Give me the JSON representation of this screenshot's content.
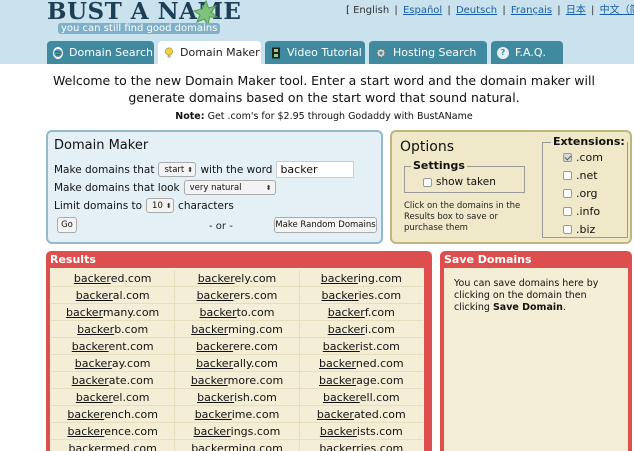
{
  "header": {
    "logo_title": "BUST A NAME",
    "logo_subtitle": "you can still find good domains",
    "languages": [
      {
        "label": "English",
        "active": true
      },
      {
        "label": "Español",
        "active": false
      },
      {
        "label": "Deutsch",
        "active": false
      },
      {
        "label": "Français",
        "active": false
      },
      {
        "label": "日本",
        "active": false
      },
      {
        "label": "中文（简体）",
        "active": false
      }
    ],
    "lang_open": "[",
    "lang_close": "]"
  },
  "tabs": [
    {
      "label": "Domain Search",
      "icon": "globe-icon",
      "active": false
    },
    {
      "label": "Domain Maker",
      "icon": "lightbulb-icon",
      "active": true
    },
    {
      "label": "Video Tutorial",
      "icon": "film-icon",
      "active": false
    },
    {
      "label": "Hosting Search",
      "icon": "gear-icon",
      "active": false
    },
    {
      "label": "F.A.Q.",
      "icon": "help-icon",
      "active": false
    }
  ],
  "welcome": {
    "text": "Welcome to the new Domain Maker tool. Enter a start word and the domain maker will generate domains based on the start word that sound natural.",
    "note_label": "Note:",
    "note_text": "Get .com's for $2.95 through Godaddy with BustAName"
  },
  "domain_maker": {
    "title": "Domain Maker",
    "row1_prefix": "Make domains that",
    "row1_select": "start",
    "row1_suffix": "with the word",
    "word_value": "backer",
    "row2_prefix": "Make domains that look",
    "row2_select": "very natural",
    "row3_prefix": "Limit domains to",
    "row3_select": "10",
    "row3_suffix": "characters",
    "go_label": "Go",
    "or_label": "- or -",
    "random_label": "Make Random Domains"
  },
  "options": {
    "title": "Options",
    "settings_legend": "Settings",
    "show_taken_label": "show taken",
    "hint": "Click on the domains in the Results box to save or purchase them",
    "extensions_legend": "Extensions:",
    "extensions": [
      {
        "label": ".com",
        "checked": true
      },
      {
        "label": ".net",
        "checked": false
      },
      {
        "label": ".org",
        "checked": false
      },
      {
        "label": ".info",
        "checked": false
      },
      {
        "label": ".biz",
        "checked": false
      }
    ]
  },
  "results": {
    "title": "Results",
    "base": "backer",
    "rows": [
      [
        "ed.com",
        "ely.com",
        "ing.com"
      ],
      [
        "al.com",
        "ers.com",
        "ies.com"
      ],
      [
        "many.com",
        "to.com",
        "f.com"
      ],
      [
        "b.com",
        "ming.com",
        "i.com"
      ],
      [
        "ent.com",
        "ere.com",
        "ist.com"
      ],
      [
        "ay.com",
        "ally.com",
        "ned.com"
      ],
      [
        "ate.com",
        "more.com",
        "age.com"
      ],
      [
        "el.com",
        "ish.com",
        "ell.com"
      ],
      [
        "ench.com",
        "ime.com",
        "ated.com"
      ],
      [
        "ence.com",
        "ings.com",
        "ists.com"
      ],
      [
        "med.com",
        "ming.com",
        "ries.com"
      ]
    ]
  },
  "save": {
    "title": "Save Domains",
    "text_before": "You can save domains here by clicking on the domain then clicking",
    "text_bold": "Save Domain",
    "text_after": "."
  },
  "colors": {
    "header_bg": "#c9e2ee",
    "tab_bg": "#3f8a9f",
    "results_red": "#dd4f4f",
    "panel_cream": "#f4eed6"
  }
}
